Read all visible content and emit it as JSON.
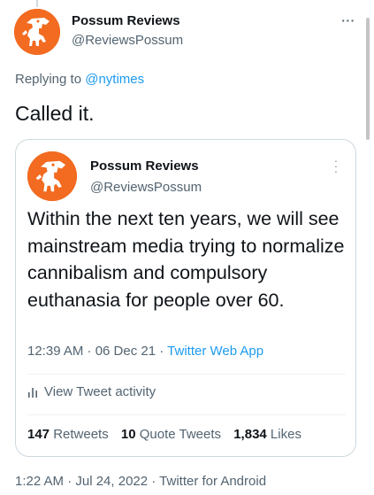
{
  "tweet": {
    "author_name": "Possum Reviews",
    "author_handle": "@ReviewsPossum",
    "more_icon": "more-horizontal-icon",
    "replying_to_prefix": "Replying to ",
    "replying_to_handle": "@nytimes",
    "text": "Called it.",
    "timestamp": "1:22 AM · Jul 24, 2022 · Twitter for Android"
  },
  "quoted_tweet": {
    "author_name": "Possum Reviews",
    "author_handle": "@ReviewsPossum",
    "more_icon": "more-vertical-icon",
    "text": "Within the next ten years, we will see mainstream media trying to normalize cannibalism and compulsory euthanasia for people over 60.",
    "time": "12:39 AM · 06 Dec 21 · ",
    "source": "Twitter Web App",
    "activity_label": "View Tweet activity",
    "activity_icon": "bar-chart-icon",
    "stats": {
      "retweets_count": "147",
      "retweets_label": " Retweets",
      "quotes_count": "10",
      "quotes_label": " Quote Tweets",
      "likes_count": "1,834",
      "likes_label": " Likes"
    }
  },
  "colors": {
    "avatar_orange": "#f26b21",
    "link_blue": "#1d9bf0",
    "muted_text": "#536471",
    "primary_text": "#0f1419",
    "border": "#cfd9de"
  }
}
